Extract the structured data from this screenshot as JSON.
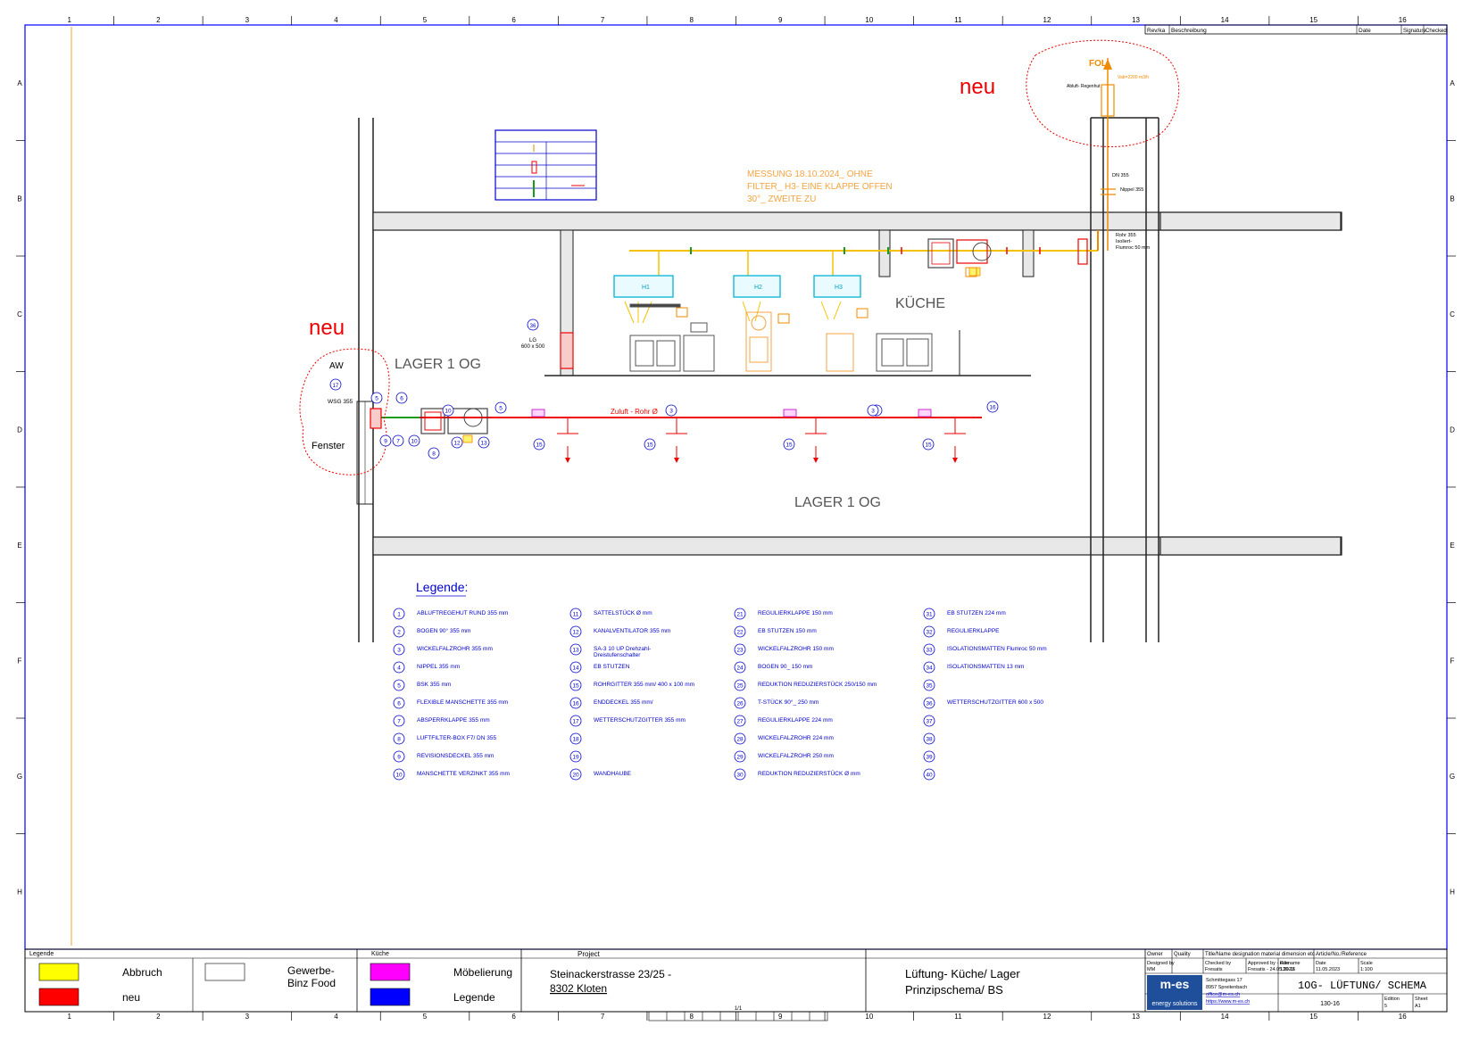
{
  "frame": {
    "columns_top": [
      "1",
      "2",
      "3",
      "4",
      "5",
      "6",
      "7",
      "8",
      "9",
      "10",
      "11",
      "12",
      "13",
      "14",
      "15",
      "16"
    ],
    "columns_bottom": [
      "1",
      "2",
      "3",
      "4",
      "5",
      "6",
      "7",
      "8",
      "9",
      "10",
      "11",
      "12",
      "13",
      "14",
      "15",
      "16"
    ],
    "rows": [
      "A",
      "B",
      "C",
      "D",
      "E",
      "F",
      "G",
      "H"
    ]
  },
  "revision_header": {
    "rev": "Rev/ka",
    "description": "Beschreibung",
    "date": "Date",
    "signature": "Signature",
    "checked": "Checked"
  },
  "annotations": {
    "neu_left": "neu",
    "neu_right": "neu",
    "fol": "FOL",
    "fol_flow": "Vab=2200 m3/h",
    "abluft_hood": "Abluft-\nRegenhut",
    "measurement": [
      "MESSUNG 18.10.2024_ OHNE",
      "FILTER_ H3- EINE KLAPPE OFFEN",
      "30°_ ZWEITE ZU"
    ],
    "dn": "DN 355",
    "nippel": "Nippel 355",
    "rohr": [
      "Rohr 355",
      "Isoliert-",
      "Flumroc 50 mm"
    ],
    "aw": "AW",
    "wsg": "WSG 355",
    "fenster": "Fenster",
    "lg": [
      "LG",
      "600 x 500"
    ],
    "lg_num": "36",
    "zuluft": "Zuluft - Rohr Ø",
    "room_lager_top": "LAGER 1 OG",
    "room_kueche": "KÜCHE",
    "room_lager_bottom": "LAGER 1 OG",
    "hood_labels": [
      "H1",
      "H2",
      "H3"
    ],
    "numbers_line": [
      "5",
      "6",
      "10",
      "5",
      "3",
      "3",
      "3",
      "16",
      "9",
      "7",
      "10",
      "8",
      "12",
      "13",
      "15",
      "15",
      "15",
      "15",
      "17"
    ]
  },
  "legend": {
    "title": "Legende:",
    "items": [
      {
        "no": "1",
        "text": "ABLUFTREGEHUT RUND 355 mm"
      },
      {
        "no": "2",
        "text": "BOGEN 90° 355 mm"
      },
      {
        "no": "3",
        "text": "WICKELFALZROHR 355 mm"
      },
      {
        "no": "4",
        "text": "NIPPEL  355 mm"
      },
      {
        "no": "5",
        "text": "BSK 355 mm"
      },
      {
        "no": "6",
        "text": "FLEXIBLE MANSCHETTE 355 mm"
      },
      {
        "no": "7",
        "text": "ABSPERRKLAPPE 355 mm"
      },
      {
        "no": "8",
        "text": "LUFTFILTER-BOX F7/ DN 355"
      },
      {
        "no": "9",
        "text": "REVISIONSDECKEL 355 mm"
      },
      {
        "no": "10",
        "text": "MANSCHETTE VERZINKT 355 mm"
      },
      {
        "no": "11",
        "text": "SATTELSTÜCK Ø mm"
      },
      {
        "no": "12",
        "text": "KANALVENTILATOR 355 mm"
      },
      {
        "no": "13",
        "text": "SA-3 10 UP Drehzahl-\nDreistufenschalter"
      },
      {
        "no": "14",
        "text": "EB STUTZEN"
      },
      {
        "no": "15",
        "text": "ROHRGITTER 355 mm/ 400 x 100 mm"
      },
      {
        "no": "16",
        "text": "ENDDECKEL 355 mm/"
      },
      {
        "no": "17",
        "text": "WETTERSCHUTZGITTER 355 mm"
      },
      {
        "no": "18",
        "text": ""
      },
      {
        "no": "19",
        "text": ""
      },
      {
        "no": "20",
        "text": "WANDHAUBE"
      },
      {
        "no": "21",
        "text": "REGULIERKLAPPE 150 mm"
      },
      {
        "no": "22",
        "text": "EB STUTZEN 150 mm"
      },
      {
        "no": "23",
        "text": "WICKELFALZROHR 150 mm"
      },
      {
        "no": "24",
        "text": "BOGEN 90_ 150 mm"
      },
      {
        "no": "25",
        "text": "REDUKTION REDUZIERSTÜCK 250/150 mm"
      },
      {
        "no": "26",
        "text": "T-STÜCK 90°_ 250 mm"
      },
      {
        "no": "27",
        "text": "REGULIERKLAPPE 224 mm"
      },
      {
        "no": "28",
        "text": "WICKELFALZROHR 224 mm"
      },
      {
        "no": "29",
        "text": "WICKELFALZROHR 250 mm"
      },
      {
        "no": "30",
        "text": "REDUKTION REDUZIERSTÜCK Ø mm"
      },
      {
        "no": "31",
        "text": "EB STUTZEN 224 mm"
      },
      {
        "no": "32",
        "text": "REGULIERKLAPPE"
      },
      {
        "no": "33",
        "text": "ISOLATIONSMATTEN Flumroc  50 mm"
      },
      {
        "no": "34",
        "text": "ISOLATIONSMATTEN 13 mm"
      },
      {
        "no": "35",
        "text": ""
      },
      {
        "no": "36",
        "text": "WETTERSCHUTZGITTER  600 x 500"
      },
      {
        "no": "37",
        "text": ""
      },
      {
        "no": "38",
        "text": ""
      },
      {
        "no": "39",
        "text": ""
      },
      {
        "no": "40",
        "text": ""
      }
    ]
  },
  "title_block": {
    "legende_label": "Legende",
    "kueche_label": "Küche",
    "colors": {
      "abbruch": "#ffff00",
      "neu": "#ff0000",
      "moebel": "#ff00ff",
      "legende": "#0000ff"
    },
    "abbruch": "Abbruch",
    "neu": "neu",
    "gewerbe": "Gewerbe-\nBinz Food",
    "moebelierung": "Möbelierung",
    "legende": "Legende",
    "project_label": "Project",
    "address1": "Steinackerstrasse 23/25 -",
    "address2": "8302 Kloten",
    "title1": "Lüftung- Küche/ Lager",
    "title2": "Prinzipschema/ BS",
    "owner_label": "Owner",
    "quality_label": "Quality",
    "designation_label": "Title/Name designation material dimension etc",
    "article_label": "Article/No./Reference",
    "designed_by_label": "Designed by",
    "designed_by": "MM",
    "checked_by_label": "Checked by",
    "checked_by": "Fresatis",
    "approved_label": "Approved by - date",
    "approved": "Fresatis - 24.05.2023",
    "filename_label": "Filename",
    "filename": "130-16",
    "date_label": "Date",
    "date": "11.05.2023",
    "scale_label": "Scale",
    "scale": "1:100",
    "company": "m-es",
    "company_sub": "energy solutions",
    "company_address": [
      "Schmittegass 17",
      "8957 Spreitenbach",
      "office@m-es.ch",
      "https://www.m-es.ch"
    ],
    "drawing_title": "1OG- LÜFTUNG/ SCHEMA",
    "drawing_no": "130-16",
    "edition_label": "Edition",
    "edition": "5",
    "sheet_label": "Sheet",
    "sheet": "A1",
    "sheet_no": "1/1"
  }
}
